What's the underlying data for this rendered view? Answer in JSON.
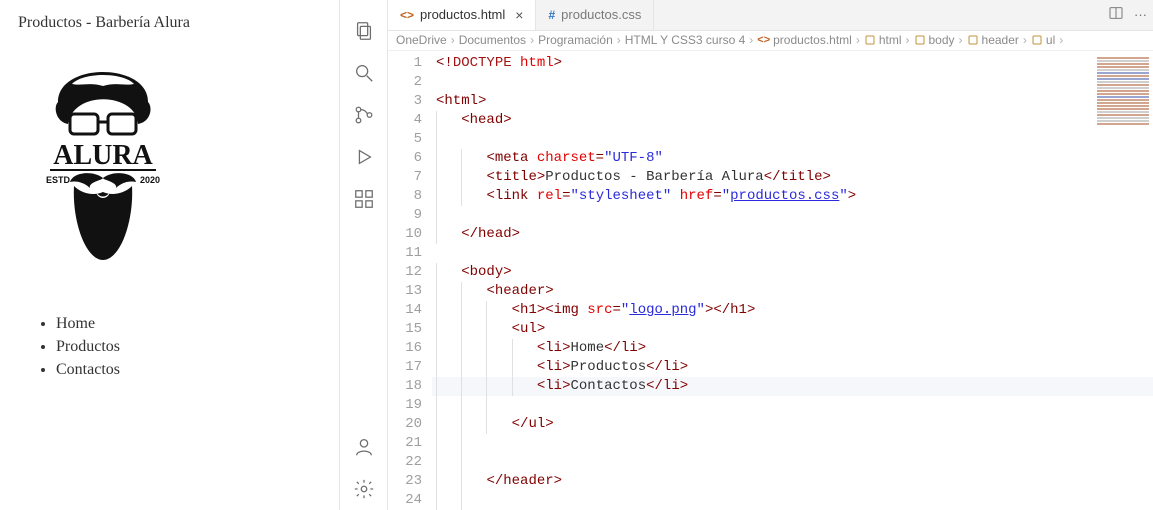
{
  "preview": {
    "title": "Productos - Barbería Alura",
    "logo_text_top": "ALURA",
    "logo_text_left": "ESTD",
    "logo_text_right": "2020",
    "nav": [
      "Home",
      "Productos",
      "Contactos"
    ]
  },
  "tabs": [
    {
      "name": "productos.html",
      "icon": "<>",
      "iconClass": "html",
      "active": true,
      "closeable": true
    },
    {
      "name": "productos.css",
      "icon": "#",
      "iconClass": "css",
      "active": false,
      "closeable": false
    }
  ],
  "breadcrumb": [
    {
      "label": "OneDrive",
      "type": "folder"
    },
    {
      "label": "Documentos",
      "type": "folder"
    },
    {
      "label": "Programación",
      "type": "folder"
    },
    {
      "label": "HTML Y CSS3 curso 4",
      "type": "folder"
    },
    {
      "label": "productos.html",
      "type": "file-html"
    },
    {
      "label": "html",
      "type": "tag"
    },
    {
      "label": "body",
      "type": "tag"
    },
    {
      "label": "header",
      "type": "tag"
    },
    {
      "label": "ul",
      "type": "tag"
    }
  ],
  "code": {
    "line_count": 24,
    "current_line": 18,
    "lines": [
      {
        "n": 1,
        "indent": 0,
        "html": "<span class='t-tag'>&lt;!</span><span class='t-doctype'>DOCTYPE</span> <span class='t-attr'>html</span><span class='t-tag'>&gt;</span>"
      },
      {
        "n": 2,
        "indent": 0,
        "html": ""
      },
      {
        "n": 3,
        "indent": 0,
        "html": "<span class='t-tag'>&lt;html&gt;</span>"
      },
      {
        "n": 4,
        "indent": 1,
        "html": "<span class='t-tag'>&lt;head&gt;</span>"
      },
      {
        "n": 5,
        "indent": 1,
        "html": ""
      },
      {
        "n": 6,
        "indent": 2,
        "html": "<span class='t-tag'>&lt;meta</span> <span class='t-attr'>charset</span><span class='t-punc'>=</span><span class='t-str'>\"UTF-8\"</span>"
      },
      {
        "n": 7,
        "indent": 2,
        "html": "<span class='t-tag'>&lt;title&gt;</span><span class='t-text'>Productos - Barbería Alura</span><span class='t-tag'>&lt;/title&gt;</span>"
      },
      {
        "n": 8,
        "indent": 2,
        "html": "<span class='t-tag'>&lt;link</span> <span class='t-attr'>rel</span><span class='t-punc'>=</span><span class='t-str'>\"stylesheet\"</span> <span class='t-attr'>href</span><span class='t-punc'>=</span><span class='t-str'>\"</span><span class='t-link'>productos.css</span><span class='t-str'>\"</span><span class='t-tag'>&gt;</span>"
      },
      {
        "n": 9,
        "indent": 1,
        "html": ""
      },
      {
        "n": 10,
        "indent": 1,
        "html": "<span class='t-tag'>&lt;/head&gt;</span>"
      },
      {
        "n": 11,
        "indent": 0,
        "html": ""
      },
      {
        "n": 12,
        "indent": 1,
        "html": "<span class='t-tag'>&lt;body&gt;</span>"
      },
      {
        "n": 13,
        "indent": 2,
        "html": "<span class='t-tag'>&lt;header&gt;</span>"
      },
      {
        "n": 14,
        "indent": 3,
        "html": "<span class='t-tag'>&lt;h1&gt;&lt;img</span> <span class='t-attr'>src</span><span class='t-punc'>=</span><span class='t-str'>\"</span><span class='t-link'>logo.png</span><span class='t-str'>\"</span><span class='t-tag'>&gt;&lt;/h1&gt;</span>"
      },
      {
        "n": 15,
        "indent": 3,
        "html": "<span class='t-tag'>&lt;ul&gt;</span>"
      },
      {
        "n": 16,
        "indent": 4,
        "html": "<span class='t-tag'>&lt;li&gt;</span><span class='t-text'>Home</span><span class='t-tag'>&lt;/li&gt;</span>"
      },
      {
        "n": 17,
        "indent": 4,
        "html": "<span class='t-tag'>&lt;li&gt;</span><span class='t-text'>Productos</span><span class='t-tag'>&lt;/li&gt;</span>"
      },
      {
        "n": 18,
        "indent": 4,
        "html": "<span class='t-tag'>&lt;li&gt;</span><span class='t-text'>Contactos</span><span class='t-tag'>&lt;/li&gt;</span>"
      },
      {
        "n": 19,
        "indent": 3,
        "html": ""
      },
      {
        "n": 20,
        "indent": 3,
        "html": "<span class='t-tag'>&lt;/ul&gt;</span>"
      },
      {
        "n": 21,
        "indent": 2,
        "html": ""
      },
      {
        "n": 22,
        "indent": 2,
        "html": ""
      },
      {
        "n": 23,
        "indent": 2,
        "html": "<span class='t-tag'>&lt;/header&gt;</span>"
      },
      {
        "n": 24,
        "indent": 2,
        "html": ""
      }
    ]
  }
}
